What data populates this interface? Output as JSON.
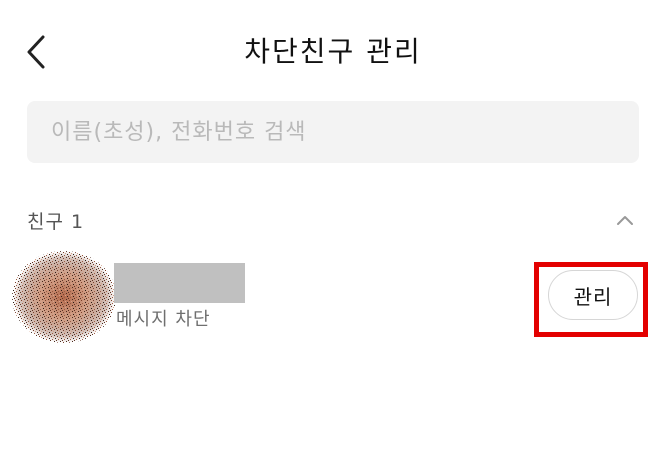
{
  "header": {
    "title": "차단친구 관리",
    "back_icon": "chevron-left-icon"
  },
  "search": {
    "placeholder": "이름(초성), 전화번호 검색",
    "value": ""
  },
  "section": {
    "title": "친구 1",
    "collapse_icon": "chevron-up-icon"
  },
  "friends": [
    {
      "status": "메시지 차단",
      "manage_label": "관리"
    }
  ],
  "colors": {
    "search_bg": "#f3f3f3",
    "highlight": "#e30000",
    "name_placeholder": "#c0c0c0"
  }
}
